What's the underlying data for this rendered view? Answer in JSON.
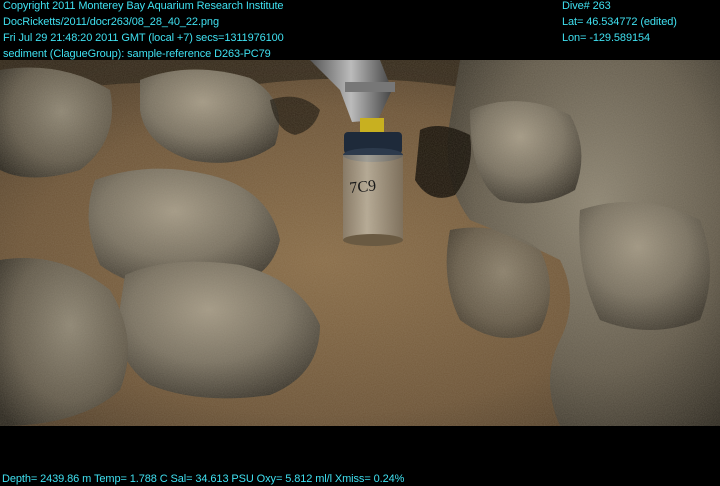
{
  "overlay": {
    "top_left": [
      "Copyright 2011 Monterey Bay Aquarium Research Institute",
      "DocRicketts/2011/docr263/08_28_40_22.png",
      "Fri Jul 29 21:48:20 2011 GMT (local +7)  secs=1311976100",
      "sediment (ClagueGroup): sample-reference D263-PC79"
    ],
    "top_right": [
      "Dive# 263",
      "Lat= 46.534772 (edited)",
      "Lon= -129.589154"
    ],
    "bottom": "Depth= 2439.86 m  Temp= 1.788 C  Sal= 34.613 PSU  Oxy= 5.812 ml/l  Xmiss= 0.24%"
  },
  "scene": {
    "tube_label": "7C9",
    "colors": {
      "overlay_text": "#3fe0f0",
      "sediment": "#7a6040",
      "rock": "#6e6658",
      "background": "#000000"
    }
  }
}
